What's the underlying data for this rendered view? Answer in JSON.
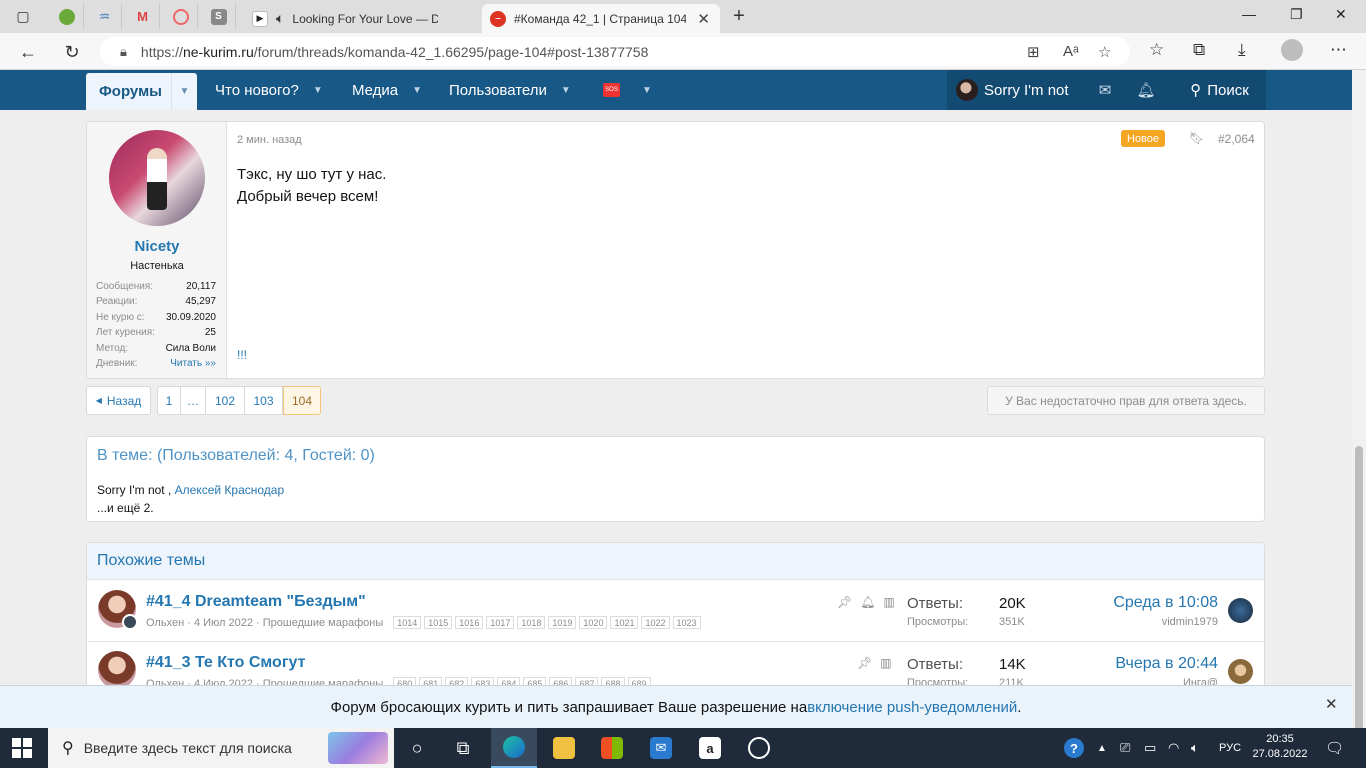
{
  "browser": {
    "tabs": [
      {
        "title": "Looking For Your Love — D"
      },
      {
        "title": "#Команда 42_1 | Страница 104"
      }
    ],
    "url_prefix": "https://",
    "url_host": "ne-kurim.ru",
    "url_path": "/forum/threads/komanda-42_1.66295/page-104#post-13877758"
  },
  "nav": {
    "forums": "Форумы",
    "whats_new": "Что нового?",
    "media": "Медиа",
    "users": "Пользователи",
    "sos_badge": "SOS",
    "username": "Sorry I'm not",
    "search": "Поиск"
  },
  "post": {
    "author": "Nicety",
    "author_title": "Настенька",
    "stats": [
      {
        "key": "Сообщения:",
        "value": "20,117"
      },
      {
        "key": "Реакции:",
        "value": "45,297"
      },
      {
        "key": "Не курю с:",
        "value": "30.09.2020"
      },
      {
        "key": "Лет курения:",
        "value": "25"
      },
      {
        "key": "Метод:",
        "value": "Сила Воли"
      },
      {
        "key": "Дневник:",
        "value": "Читать »»"
      }
    ],
    "time": "2 мин. назад",
    "new_badge": "Новое",
    "number": "#2,064",
    "body_line1": "Тэкс, ну шо тут у нас.",
    "body_line2": "Добрый вечер всем!",
    "footer": "!!!"
  },
  "pagination": {
    "back": "Назад",
    "pages": [
      "1",
      "…",
      "102",
      "103",
      "104"
    ],
    "current": "104",
    "no_permission": "У Вас недостаточно прав для ответа здесь."
  },
  "who_here": {
    "title": "В теме: (Пользователей: 4, Гостей: 0)",
    "user1": "Sorry I'm not",
    "separator": " , ",
    "user2": "Алексей Краснодар",
    "more": "...и ещё 2."
  },
  "similar": {
    "title": "Похожие темы",
    "threads": [
      {
        "title": "#41_4 Dreamteam \"Бездым\"",
        "author": "Ольхен",
        "date": "4 Июл 2022",
        "forum": "Прошедшие марафоны",
        "pages": [
          "1014",
          "1015",
          "1016",
          "1017",
          "1018",
          "1019",
          "1020",
          "1021",
          "1022",
          "1023"
        ],
        "replies_label": "Ответы:",
        "replies": "20K",
        "views_label": "Просмотры:",
        "views": "351K",
        "last": "Среда в 10:08",
        "last_user": "vidmin1979"
      },
      {
        "title": "#41_3 Те Кто Смогут",
        "author": "Ольхен",
        "date": "4 Июл 2022",
        "forum": "Прошедшие марафоны",
        "pages": [
          "680",
          "681",
          "682",
          "683",
          "684",
          "685",
          "686",
          "687",
          "688",
          "689"
        ],
        "replies_label": "Ответы:",
        "replies": "14K",
        "views_label": "Просмотры:",
        "views": "211K",
        "last": "Вчера в 20:44",
        "last_user": "Инга@"
      }
    ]
  },
  "push": {
    "text": "Форум бросающих курить и пить запрашивает Ваше разрешение на ",
    "link": "включение push-уведомлений",
    "end": "."
  },
  "taskbar": {
    "search_placeholder": "Введите здесь текст для поиска",
    "lang": "РУС",
    "time": "20:35",
    "date": "27.08.2022"
  }
}
